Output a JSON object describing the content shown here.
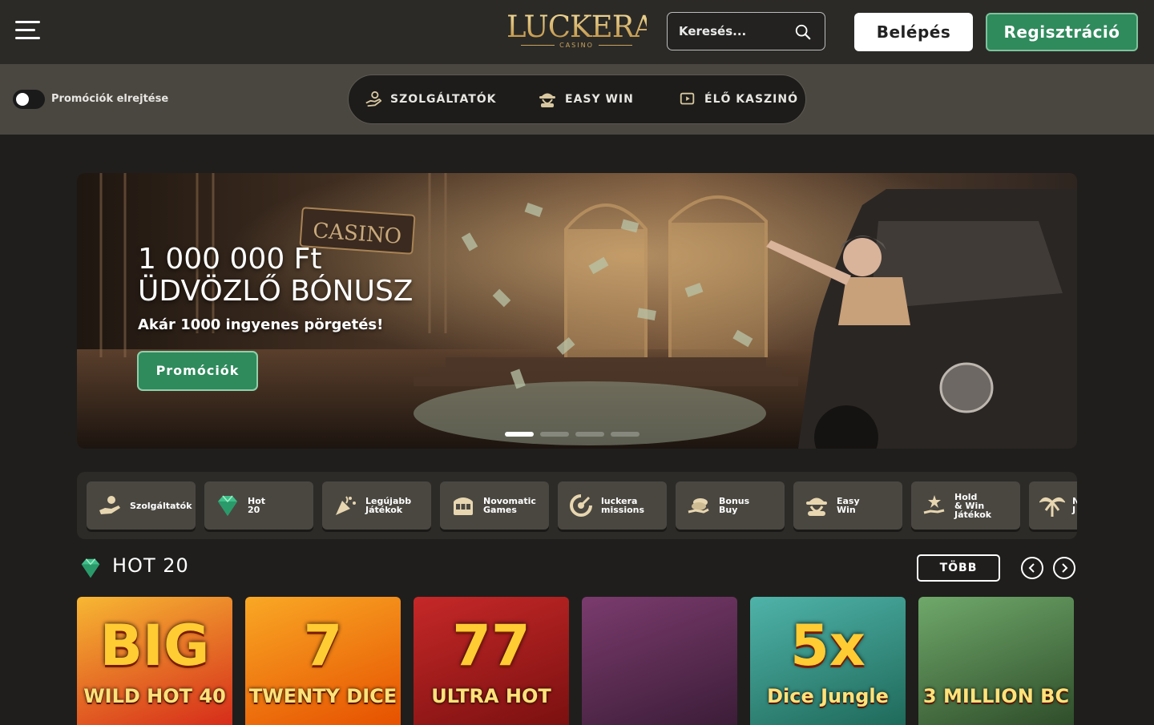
{
  "header": {
    "logo": {
      "word": "LUCKERA",
      "sub": "CASINO"
    },
    "search": {
      "placeholder": "Keresés..."
    },
    "login_label": "Belépés",
    "register_label": "Regisztráció"
  },
  "subbar": {
    "toggle_label": "Promóciók elrejtése",
    "toggle_on": false,
    "nav": [
      {
        "label": "SZOLGÁLTATÓK",
        "icon": "hand-coin-icon"
      },
      {
        "label": "EASY WIN",
        "icon": "gangster-icon"
      },
      {
        "label": "ÉLŐ KASZINÓ",
        "icon": "live-play-icon"
      }
    ]
  },
  "banner": {
    "title_line1": "1 000 000 Ft",
    "title_line2": "ÜDVÖZLŐ BÓNUSZ",
    "subtitle": "Akár 1000 ingyenes pörgetés!",
    "button_label": "Promóciók",
    "image_sign": "CASINO",
    "slides": 5,
    "active_slide": 1
  },
  "categories": [
    {
      "label": "Szolgáltatók",
      "icon": "hand-coin-icon"
    },
    {
      "label": "Hot\n20",
      "icon": "diamond-icon"
    },
    {
      "label": "Legújabb\nJátékok",
      "icon": "party-popper-icon"
    },
    {
      "label": "Novomatic\nGames",
      "icon": "slot-machine-icon"
    },
    {
      "label": "luckera\nmissions",
      "icon": "target-icon"
    },
    {
      "label": "Bonus\nBuy",
      "icon": "coins-hand-icon"
    },
    {
      "label": "Easy\nWin",
      "icon": "gangster-icon"
    },
    {
      "label": "Hold\n& Win\nJátékok",
      "icon": "hold-win-icon"
    },
    {
      "label": "N\nJ",
      "icon": "palm-icon"
    }
  ],
  "hot_section": {
    "title": "HOT 20",
    "more_label": "TÖBB",
    "games": [
      {
        "name": "WILD HOT 40",
        "small": "BIG",
        "colors": [
          "#f7b733",
          "#d62c1a"
        ]
      },
      {
        "name": "TWENTY DICE",
        "small": "7",
        "colors": [
          "#f9a825",
          "#e65100"
        ]
      },
      {
        "name": "ULTRA HOT",
        "small": "77",
        "colors": [
          "#c62828",
          "#7b1010"
        ]
      },
      {
        "name": "",
        "small": "",
        "colors": [
          "#7a3b6d",
          "#3c1d38"
        ]
      },
      {
        "name": "Dice Jungle",
        "small": "5x",
        "colors": [
          "#4fb3a9",
          "#1f6a5a"
        ]
      },
      {
        "name": "3 MILLION BC",
        "small": "",
        "colors": [
          "#6fa86a",
          "#2f4d2a"
        ]
      }
    ]
  },
  "colors": {
    "accent_green": "#2f8a5c",
    "gold": "#d8b56a",
    "gem": "#3fbf8a"
  }
}
